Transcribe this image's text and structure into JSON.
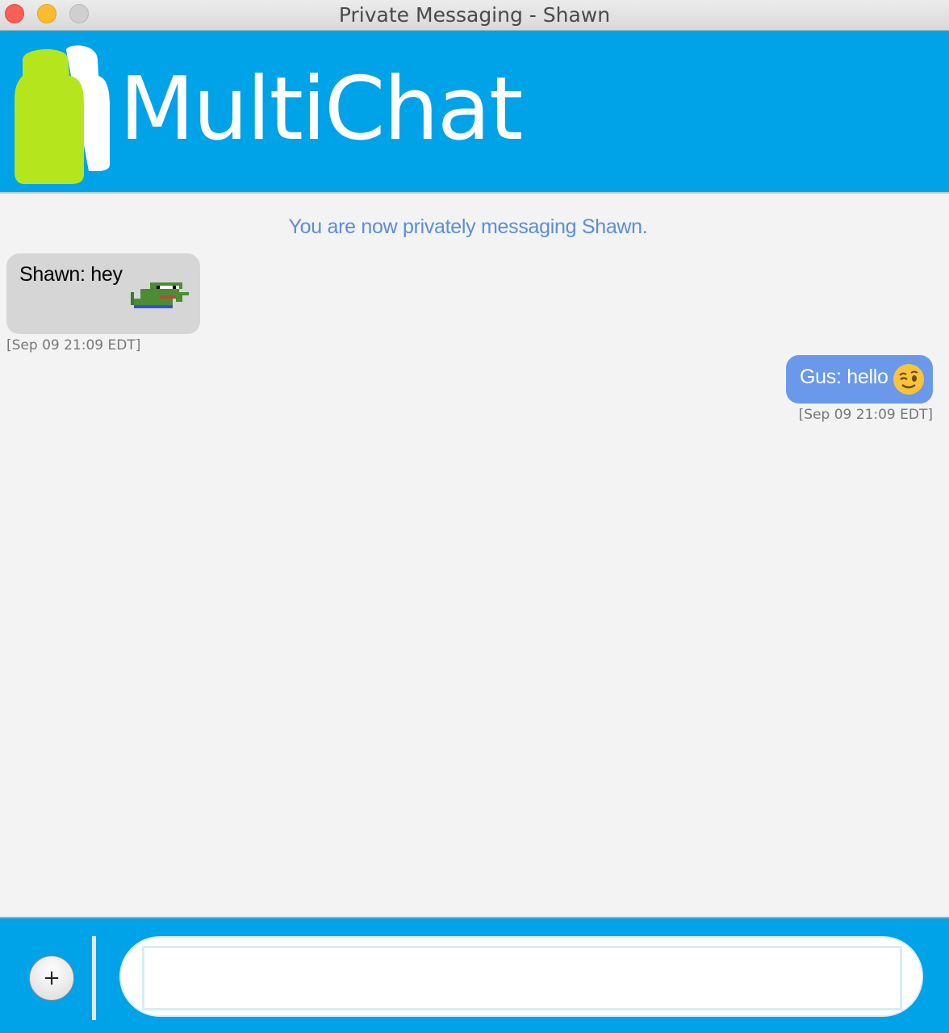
{
  "window": {
    "title": "Private Messaging - Shawn"
  },
  "header": {
    "logo_text": "MultiChat"
  },
  "chat": {
    "notice": "You are now privately messaging Shawn.",
    "messages": [
      {
        "text": "Shawn: hey",
        "emoji": "pepe-frog-icon",
        "timestamp": "[Sep 09 21:09 EDT]",
        "side": "left"
      },
      {
        "text": "Gus: hello",
        "emoji": "winking-face-icon",
        "timestamp": "[Sep 09 21:09 EDT]",
        "side": "right"
      }
    ]
  },
  "composer": {
    "add_label": "+",
    "input_value": ""
  },
  "colors": {
    "header": "#00a2e8",
    "incoming_bubble": "#d6d6d6",
    "outgoing_bubble": "#6a99eb",
    "notice": "#5b8ed8"
  }
}
